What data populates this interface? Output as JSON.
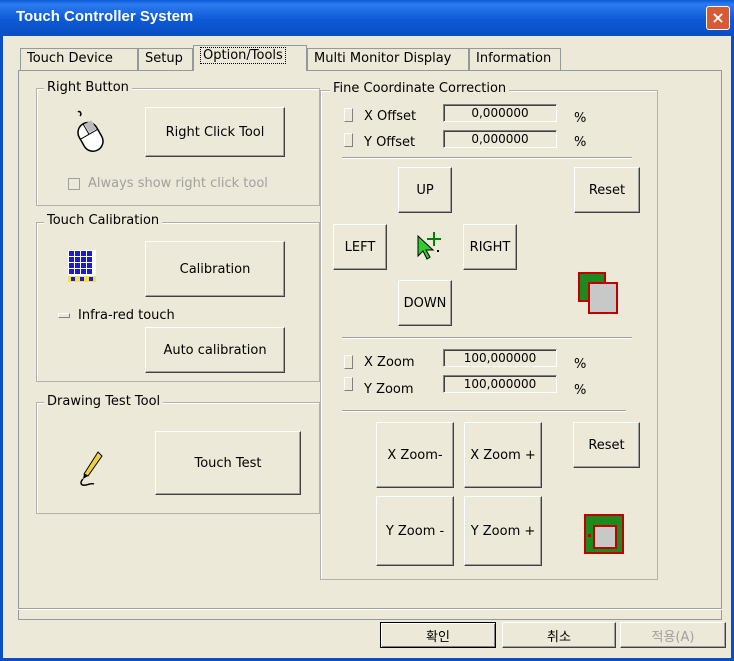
{
  "window": {
    "title": "Touch Controller System",
    "close_label": "×"
  },
  "tabs": [
    {
      "label": "Touch Device"
    },
    {
      "label": "Setup"
    },
    {
      "label": "Option/Tools"
    },
    {
      "label": "Multi Monitor Display"
    },
    {
      "label": "Information"
    }
  ],
  "right_button": {
    "group_label": "Right Button",
    "tool_button": "Right Click Tool",
    "always_show_label": "Always show right click tool"
  },
  "touch_calibration": {
    "group_label": "Touch Calibration",
    "calibration_button": "Calibration",
    "infrared_label": "Infra-red touch",
    "auto_button": "Auto calibration"
  },
  "drawing_test": {
    "group_label": "Drawing Test Tool",
    "touch_test_button": "Touch Test"
  },
  "fine_correction": {
    "group_label": "Fine Coordinate Correction",
    "x_offset_label": "X Offset",
    "x_offset_value": "0,000000",
    "y_offset_label": "Y Offset",
    "y_offset_value": "0,000000",
    "percent": "%",
    "up": "UP",
    "down": "DOWN",
    "left": "LEFT",
    "right": "RIGHT",
    "reset_offset": "Reset",
    "x_zoom_label": "X Zoom",
    "x_zoom_value": "100,000000",
    "y_zoom_label": "Y Zoom",
    "y_zoom_value": "100,000000",
    "x_zoom_minus": "X Zoom-",
    "x_zoom_plus": "X Zoom +",
    "y_zoom_minus": "Y Zoom -",
    "y_zoom_plus": "Y Zoom +",
    "reset_zoom": "Reset"
  },
  "footer": {
    "ok": "확인",
    "cancel": "취소",
    "apply": "적용(A)"
  }
}
